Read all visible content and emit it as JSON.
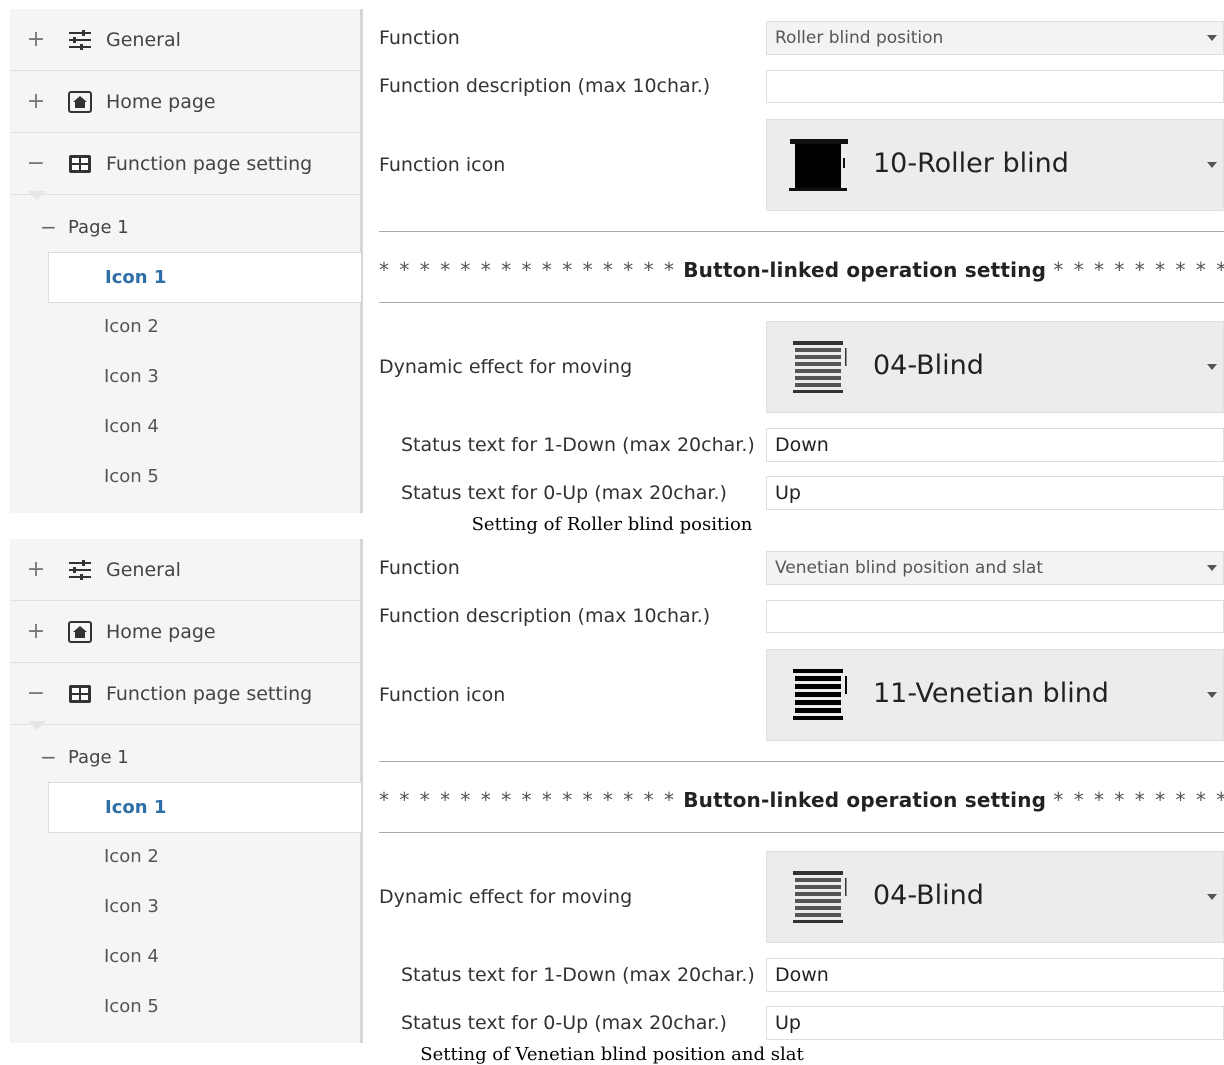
{
  "panels": [
    {
      "sidebar": {
        "nodes": [
          {
            "expander": "+",
            "icon": "sliders-icon",
            "label": "General"
          },
          {
            "expander": "+",
            "icon": "home-icon",
            "label": "Home page"
          },
          {
            "expander": "−",
            "icon": "grid-icon",
            "label": "Function page setting"
          }
        ],
        "page": {
          "expander": "−",
          "label": "Page 1"
        },
        "icons": [
          "Icon 1",
          "Icon 2",
          "Icon 3",
          "Icon 4",
          "Icon 5"
        ],
        "selected_icon": "Icon 1"
      },
      "form": {
        "function_label": "Function",
        "function_value": "Roller blind position",
        "description_label": "Function description (max 10char.)",
        "description_value": "",
        "icon_label": "Function icon",
        "icon_value": "10-Roller blind",
        "icon_glyph": "roller-blind-icon",
        "section_stars_left": "* * * * * * * * * * * * * * *",
        "section_title": "Button-linked operation setting",
        "section_stars_right": "* * * * * * * * * * * * * * *",
        "dynamic_label": "Dynamic effect for moving",
        "dynamic_value": "04-Blind",
        "dynamic_glyph": "blind-icon",
        "down_label": "Status text for 1-Down (max 20char.)",
        "down_value": "Down",
        "up_label": "Status text for 0-Up (max 20char.)",
        "up_value": "Up"
      },
      "caption": "Setting of Roller blind position"
    },
    {
      "sidebar": {
        "nodes": [
          {
            "expander": "+",
            "icon": "sliders-icon",
            "label": "General"
          },
          {
            "expander": "+",
            "icon": "home-icon",
            "label": "Home page"
          },
          {
            "expander": "−",
            "icon": "grid-icon",
            "label": "Function page setting"
          }
        ],
        "page": {
          "expander": "−",
          "label": "Page 1"
        },
        "icons": [
          "Icon 1",
          "Icon 2",
          "Icon 3",
          "Icon 4",
          "Icon 5"
        ],
        "selected_icon": "Icon 1"
      },
      "form": {
        "function_label": "Function",
        "function_value": "Venetian blind position and slat",
        "description_label": "Function description (max 10char.)",
        "description_value": "",
        "icon_label": "Function icon",
        "icon_value": "11-Venetian blind",
        "icon_glyph": "venetian-blind-icon",
        "section_stars_left": "* * * * * * * * * * * * * * *",
        "section_title": "Button-linked operation setting",
        "section_stars_right": "* * * * * * * * * * * * * * *",
        "dynamic_label": "Dynamic effect for moving",
        "dynamic_value": "04-Blind",
        "dynamic_glyph": "blind-icon",
        "down_label": "Status text for 1-Down (max 20char.)",
        "down_value": "Down",
        "up_label": "Status text for 0-Up (max 20char.)",
        "up_value": "Up"
      },
      "caption": "Setting of Venetian blind position and slat"
    }
  ],
  "colors": {
    "selected_text": "#2f6fa8",
    "sidebar_bg": "#f5f5f5",
    "select_bg": "#ececec"
  }
}
